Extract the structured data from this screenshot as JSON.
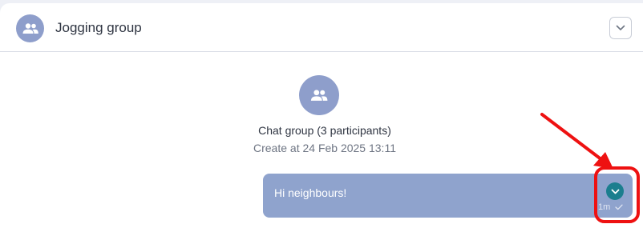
{
  "header": {
    "title": "Jogging group",
    "avatar_icon": "group-icon",
    "collapse_icon": "chevron-down-icon"
  },
  "group": {
    "avatar_icon": "group-icon",
    "name": "Chat group (3 participants)",
    "created": "Create at 24 Feb 2025 13:11"
  },
  "message": {
    "text": "Hi neighbours!",
    "time": "1m",
    "status_icon": "check-icon",
    "menu_icon": "chevron-down-icon"
  },
  "colors": {
    "avatar": "#8e9ecb",
    "bubble": "#8fa3cd",
    "menu_button": "#1b7e8e",
    "annotation": "#ee1111"
  }
}
